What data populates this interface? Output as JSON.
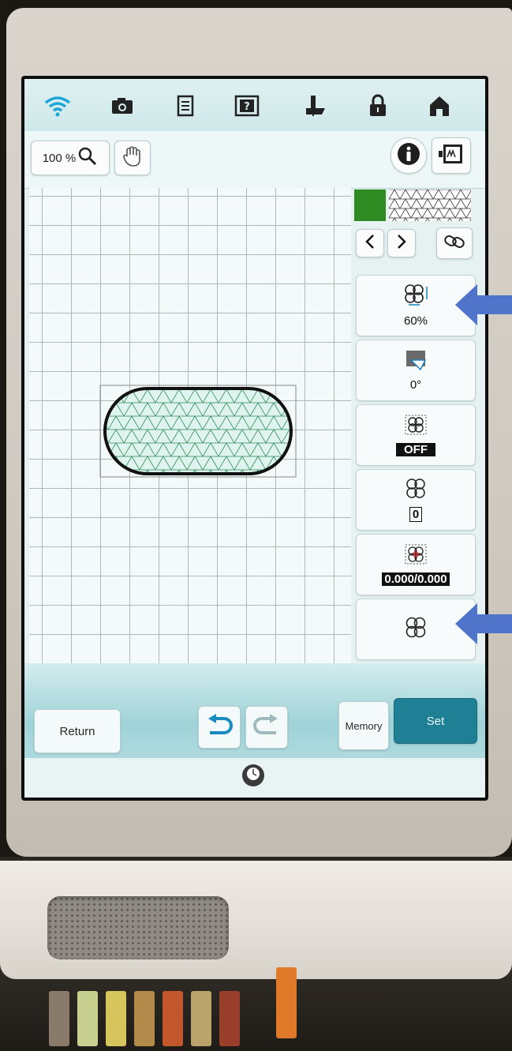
{
  "toolbar": {
    "zoom_label": "100 %",
    "icons": [
      "wifi-icon",
      "camera-icon",
      "document-icon",
      "help-icon",
      "presser-foot-icon",
      "lock-icon",
      "home-icon"
    ]
  },
  "panel": {
    "size_value": "60%",
    "rotate_value": "0°",
    "fill_value": "OFF",
    "density_value": "0",
    "offset_value": "0.000/0.000"
  },
  "bottom": {
    "return_label": "Return",
    "memory_label": "Memory",
    "set_label": "Set"
  },
  "colors": {
    "accent": "#1f7f94",
    "thread_color": "#2e8b22",
    "annotation_arrow": "#4f74c9"
  }
}
